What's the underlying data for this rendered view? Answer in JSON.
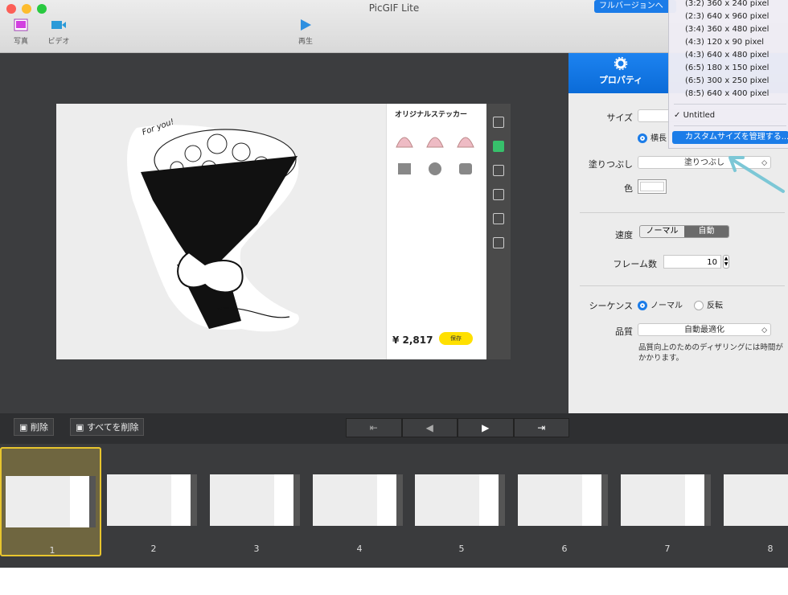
{
  "window": {
    "title": "PicGIF Lite",
    "full_version_label": "フルバージョンへ"
  },
  "toolbar": {
    "photo_label": "写真",
    "video_label": "ビデオ",
    "play_label": "再生"
  },
  "preview": {
    "sticker_title": "オリジナルステッカー",
    "price": "¥ 2,817",
    "save_label": "保存",
    "handwriting": "For you!"
  },
  "properties": {
    "tab_label": "プロパティ",
    "size_label": "サイズ",
    "orientation_label": "横長",
    "fill_label": "塗りつぶし",
    "fill_value": "塗りつぶし",
    "color_label": "色",
    "speed_label": "速度",
    "speed_options": [
      "ノーマル",
      "自動"
    ],
    "speed_selected": "自動",
    "frames_label": "フレーム数",
    "frames_value": "10",
    "sequence_label": "シーケンス",
    "sequence_normal": "ノーマル",
    "sequence_reverse": "反転",
    "quality_label": "品質",
    "quality_value": "自動最適化",
    "quality_note": "品質向上のためのディザリングには時間がかかります。"
  },
  "size_dropdown": {
    "items": [
      "(3:2) 360 x 240 pixel",
      "(2:3) 640 x 960 pixel",
      "(3:4) 360 x 480 pixel",
      "(4:3) 120 x 90 pixel",
      "(4:3) 640 x 480 pixel",
      "(6:5) 180 x 150 pixel",
      "(6:5) 300 x 250 pixel",
      "(8:5) 640 x 400 pixel"
    ],
    "checked_item": "Untitled",
    "manage_label": "カスタムサイズを管理する..."
  },
  "frame_controls": {
    "delete_label": "削除",
    "delete_all_label": "すべてを削除"
  },
  "frames": [
    "1",
    "2",
    "3",
    "4",
    "5",
    "6",
    "7",
    "8"
  ],
  "colors": {
    "accent": "#1b7ce8",
    "selection": "#e8c52e",
    "arrow": "#7cc7d6"
  }
}
